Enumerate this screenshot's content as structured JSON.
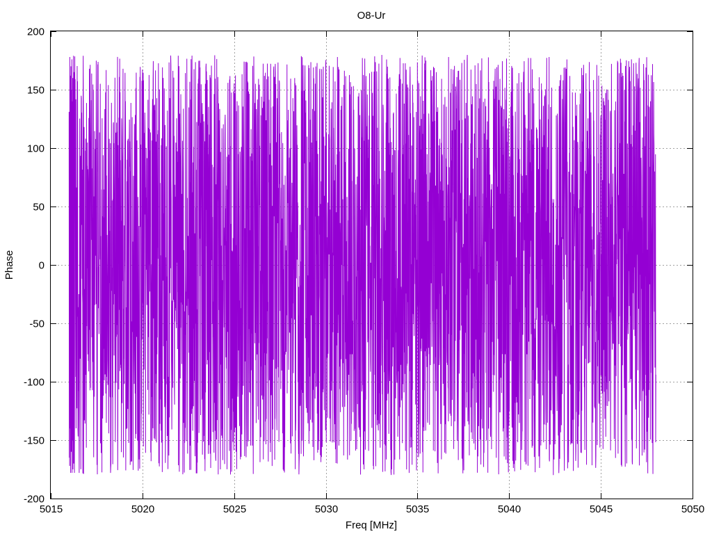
{
  "chart_data": {
    "type": "line",
    "title": "O8-Ur",
    "xlabel": "Freq [MHz]",
    "ylabel": "Phase",
    "xlim": [
      5015,
      5050
    ],
    "ylim": [
      -200,
      200
    ],
    "xticks": [
      5015,
      5020,
      5025,
      5030,
      5035,
      5040,
      5045,
      5050
    ],
    "yticks": [
      -200,
      -150,
      -100,
      -50,
      0,
      50,
      100,
      150,
      200
    ],
    "grid": true,
    "series": [
      {
        "color": "#9400d3",
        "x_range": [
          5016,
          5048
        ],
        "point_count": 3200,
        "value_range": [
          -180,
          180
        ],
        "description_values": [
          131,
          -165,
          98,
          -172,
          178,
          -140,
          55,
          162,
          -178,
          -120,
          170,
          45,
          -160,
          150,
          -60,
          176,
          -178,
          20,
          140,
          -150,
          160,
          -175,
          110,
          -90,
          179,
          -170,
          75,
          -130,
          165,
          -178
        ]
      }
    ]
  }
}
